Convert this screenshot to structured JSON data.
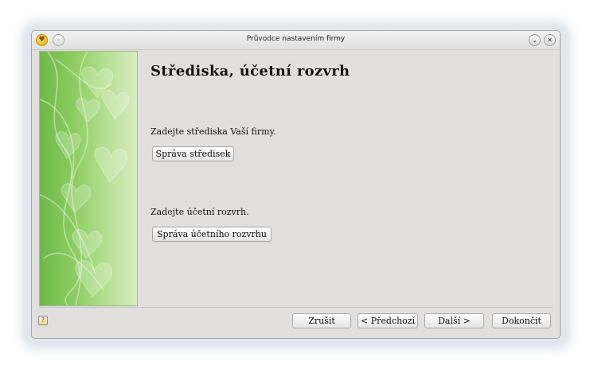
{
  "window": {
    "title": "Průvodce nastavením firmy",
    "menu_glyph": "◦",
    "minimize_glyph": "⌄",
    "close_glyph": "✕"
  },
  "colors": {
    "window_bg": "#e2e0df",
    "side_green_dark": "#6fb84a",
    "side_green_light": "#d6eec2"
  },
  "page": {
    "heading": "Střediska, účetní rozvrh",
    "cost_centers": {
      "label": "Zadejte střediska Vaší firmy.",
      "button": "Správa středisek"
    },
    "chart_of_accounts": {
      "label": "Zadejte účetní rozvrh.",
      "button": "Správa účetního rozvrhu"
    }
  },
  "footer": {
    "help_glyph": "?",
    "cancel": "Zrušit",
    "back": "< Předchozí",
    "next": "Další >",
    "finish": "Dokončit"
  }
}
